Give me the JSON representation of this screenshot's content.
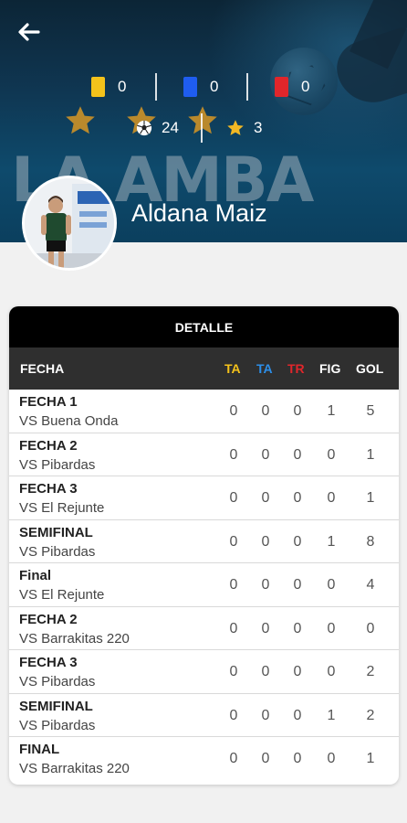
{
  "player": {
    "name": "Aldana Maiz",
    "watermark": "LA AMBA"
  },
  "cards": {
    "yellow": {
      "value": "0",
      "color": "#f4c21b"
    },
    "blue": {
      "value": "0",
      "color": "#1f5df0"
    },
    "red": {
      "value": "0",
      "color": "#e0262b"
    }
  },
  "stats": {
    "goals": "24",
    "mvp": "3"
  },
  "colors": {
    "header_bg": "#0f3550",
    "star": "#b9892c",
    "mini_star": "#f2b824"
  },
  "detail": {
    "title": "DETALLE",
    "columns": [
      {
        "label": "FECHA",
        "color": "#ffffff"
      },
      {
        "label": "TA",
        "color": "#f4c21b"
      },
      {
        "label": "TA",
        "color": "#2c8ee8"
      },
      {
        "label": "TR",
        "color": "#e0262b"
      },
      {
        "label": "FIG",
        "color": "#ffffff"
      },
      {
        "label": "GOL",
        "color": "#ffffff"
      }
    ],
    "rows": [
      {
        "fecha": "FECHA 1",
        "vs": "VS Buena Onda",
        "ta_y": "0",
        "ta_b": "0",
        "tr": "0",
        "fig": "1",
        "gol": "5"
      },
      {
        "fecha": "FECHA 2",
        "vs": "VS Pibardas",
        "ta_y": "0",
        "ta_b": "0",
        "tr": "0",
        "fig": "0",
        "gol": "1"
      },
      {
        "fecha": "FECHA 3",
        "vs": "VS El Rejunte",
        "ta_y": "0",
        "ta_b": "0",
        "tr": "0",
        "fig": "0",
        "gol": "1"
      },
      {
        "fecha": "SEMIFINAL",
        "vs": "VS Pibardas",
        "ta_y": "0",
        "ta_b": "0",
        "tr": "0",
        "fig": "1",
        "gol": "8"
      },
      {
        "fecha": "Final",
        "vs": "VS El Rejunte",
        "ta_y": "0",
        "ta_b": "0",
        "tr": "0",
        "fig": "0",
        "gol": "4"
      },
      {
        "fecha": "FECHA 2",
        "vs": "VS Barrakitas 220",
        "ta_y": "0",
        "ta_b": "0",
        "tr": "0",
        "fig": "0",
        "gol": "0"
      },
      {
        "fecha": "FECHA 3",
        "vs": "VS Pibardas",
        "ta_y": "0",
        "ta_b": "0",
        "tr": "0",
        "fig": "0",
        "gol": "2"
      },
      {
        "fecha": "SEMIFINAL",
        "vs": "VS Pibardas",
        "ta_y": "0",
        "ta_b": "0",
        "tr": "0",
        "fig": "1",
        "gol": "2"
      },
      {
        "fecha": "FINAL",
        "vs": "VS Barrakitas 220",
        "ta_y": "0",
        "ta_b": "0",
        "tr": "0",
        "fig": "0",
        "gol": "1"
      }
    ]
  }
}
